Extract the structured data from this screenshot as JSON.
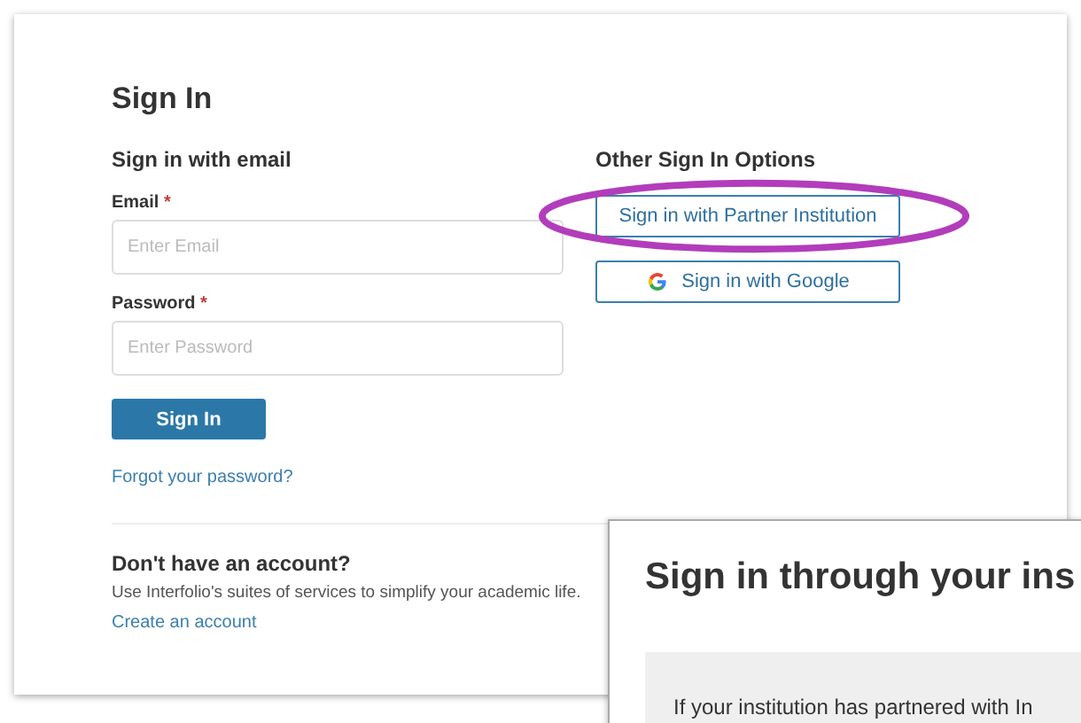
{
  "title": "Sign In",
  "email_section": {
    "heading": "Sign in with email",
    "fields": [
      {
        "label": "Email",
        "required_mark": "*",
        "placeholder": "Enter Email"
      },
      {
        "label": "Password",
        "required_mark": "*",
        "placeholder": "Enter Password"
      }
    ],
    "submit": "Sign In",
    "forgot_link": "Forgot your password?"
  },
  "other_options": {
    "heading": "Other Sign In Options",
    "buttons": [
      {
        "label": "Sign in with Partner Institution",
        "kind": "partner",
        "highlighted": true
      },
      {
        "label": "Sign in with Google",
        "kind": "google",
        "highlighted": false
      }
    ]
  },
  "account": {
    "heading": "Don't have an account?",
    "description": "Use Interfolio's suites of services to simplify your academic life.",
    "link": "Create an account"
  },
  "overlay": {
    "title": "Sign in through your ins",
    "notice": "If your institution has partnered with In"
  }
}
